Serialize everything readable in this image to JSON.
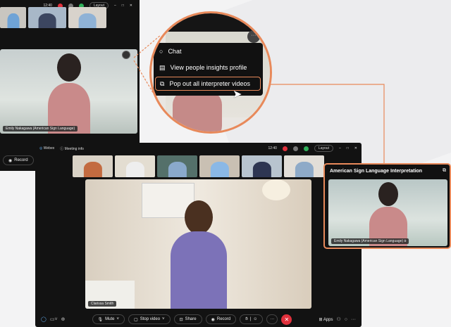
{
  "back_window": {
    "time": "12:40",
    "layout_label": "Layout",
    "caption": "Emily Nakagawa (American Sign Language)",
    "record_label": "Record"
  },
  "magnifier_menu": {
    "items": [
      {
        "icon": "chat-icon",
        "label": "Chat"
      },
      {
        "icon": "profile-card-icon",
        "label": "View people insights profile"
      },
      {
        "icon": "pop-out-icon",
        "label": "Pop out all interpreter videos"
      }
    ]
  },
  "front_window": {
    "app_name": "Webex",
    "meeting_info": "Meeting info",
    "time": "12:40",
    "layout_label": "Layout",
    "main_caption": "Clarissa Smith",
    "toolbar": {
      "mute": "Mute",
      "stop_video": "Stop video",
      "share": "Share",
      "record": "Record",
      "apps": "Apps"
    }
  },
  "popout": {
    "title": "American Sign Language Interpretation",
    "caption": "Emily Nakagawa (American Sign Language)"
  },
  "colors": {
    "accent": "#e8895a",
    "end_call": "#e0303c",
    "green": "#2fb05a"
  }
}
